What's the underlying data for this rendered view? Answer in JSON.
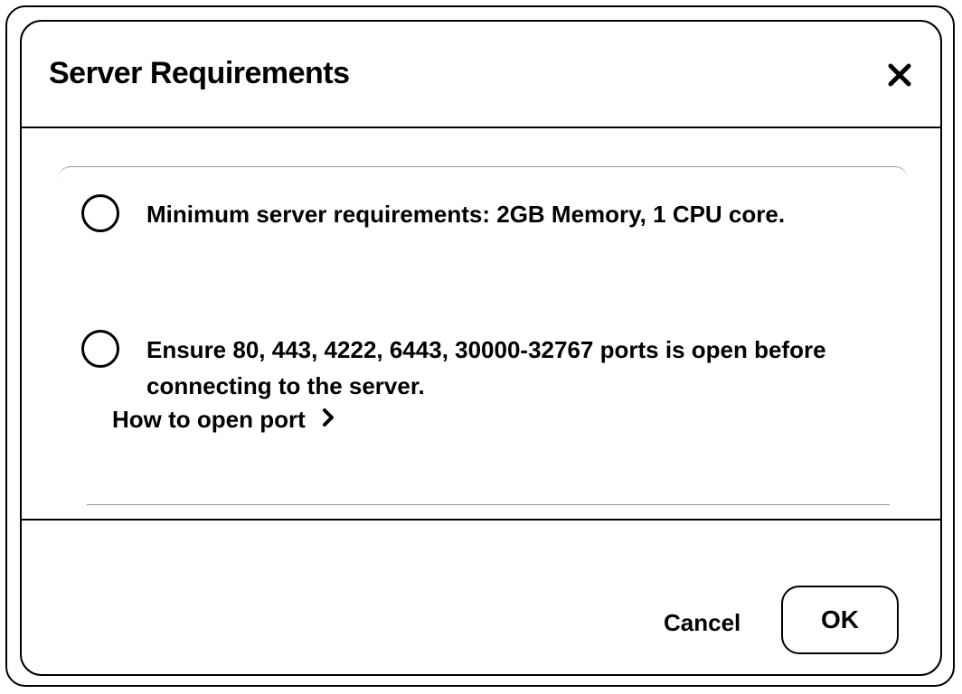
{
  "dialog": {
    "title": "Server Requirements",
    "close_icon": "close-icon"
  },
  "requirements": [
    {
      "text": "Minimum server requirements: 2GB Memory, 1 CPU core."
    },
    {
      "text": "Ensure 80, 443, 4222, 6443, 30000-32767 ports is open before connecting to the server."
    }
  ],
  "help_link": {
    "label": "How to open port",
    "icon": "chevron-right-icon"
  },
  "footer": {
    "cancel_label": "Cancel",
    "ok_label": "OK"
  }
}
